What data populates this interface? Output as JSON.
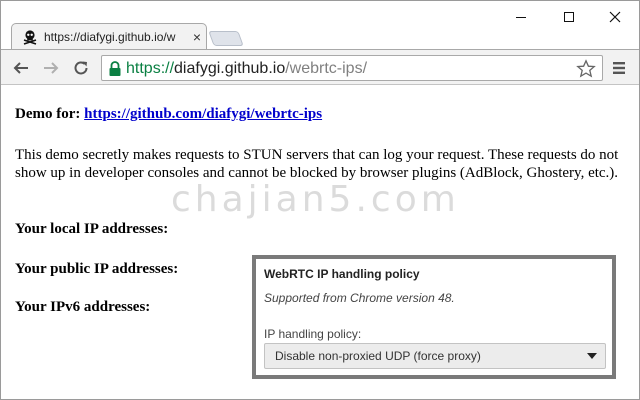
{
  "browser": {
    "tab": {
      "title": "https://diafygi.github.io/w",
      "favicon": "skull-crossbones-icon",
      "close_symbol": "×"
    },
    "window_controls": [
      "minimize-icon",
      "maximize-icon",
      "close-icon"
    ],
    "toolbar": {
      "back": "back-arrow-icon",
      "forward": "forward-arrow-icon",
      "reload": "reload-icon",
      "url": {
        "scheme": "https://",
        "host": "diafygi.github.io",
        "path": "/webrtc-ips/"
      },
      "secure_color": "#0b8043"
    }
  },
  "page": {
    "demo_label": "Demo for:",
    "demo_link": "https://github.com/diafygi/webrtc-ips",
    "description": "This demo secretly makes requests to STUN servers that can log your request. These requests do not show up in developer consoles and cannot be blocked by browser plugins (AdBlock, Ghostery, etc.).",
    "local_heading": "Your local IP addresses:",
    "public_heading": "Your public IP addresses:",
    "ipv6_heading": "Your IPv6 addresses:",
    "watermark": "chajian5.com",
    "link_color": "#0000cc"
  },
  "policy_panel": {
    "title": "WebRTC IP handling policy",
    "note": "Supported from Chrome version 48.",
    "label": "IP handling policy:",
    "selected_option": "Disable non-proxied UDP (force proxy)"
  }
}
